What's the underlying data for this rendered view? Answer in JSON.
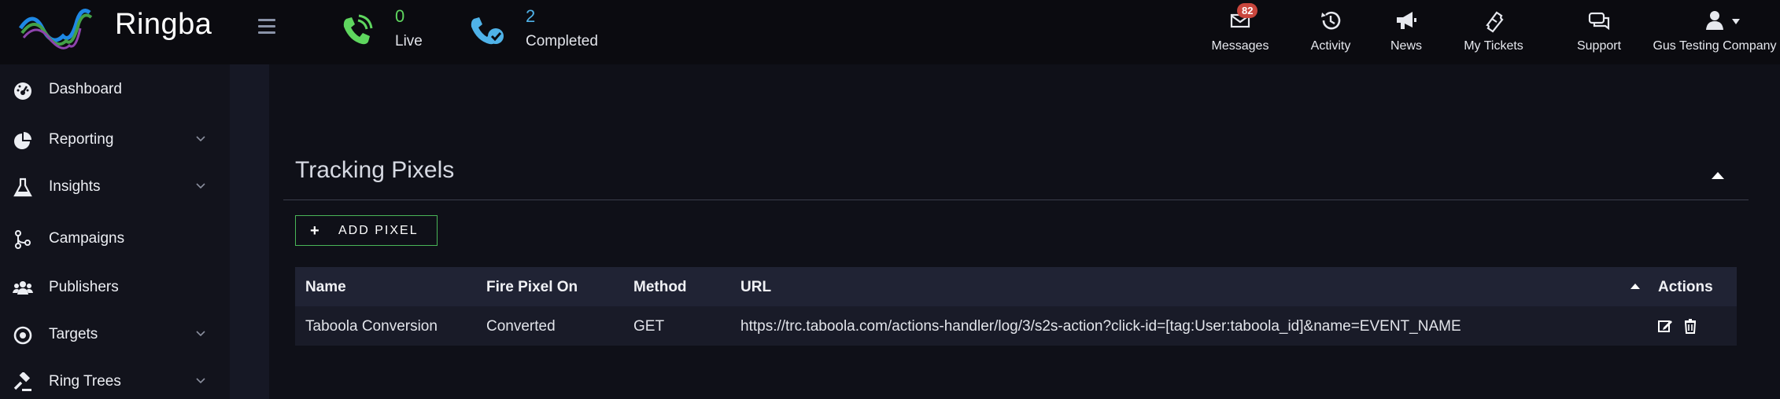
{
  "brand": {
    "name": "Ringba"
  },
  "stats": {
    "live": {
      "count": "0",
      "label": "Live",
      "icon": "phone-live-icon",
      "color": "#5fd65f"
    },
    "completed": {
      "count": "2",
      "label": "Completed",
      "icon": "phone-check-icon",
      "color": "#4fb2e8"
    }
  },
  "topnav": {
    "messages": {
      "label": "Messages",
      "badge": "82",
      "icon": "envelope-icon"
    },
    "activity": {
      "label": "Activity",
      "icon": "history-icon"
    },
    "news": {
      "label": "News",
      "icon": "megaphone-icon"
    },
    "tickets": {
      "label": "My Tickets",
      "icon": "ticket-icon"
    },
    "support": {
      "label": "Support",
      "icon": "chat-icon"
    },
    "account": {
      "label": "Gus Testing Company",
      "icon": "user-icon"
    }
  },
  "sidebar": {
    "items": [
      {
        "label": "Dashboard",
        "icon": "dashboard-icon",
        "expandable": false
      },
      {
        "label": "Reporting",
        "icon": "pie-chart-icon",
        "expandable": true
      },
      {
        "label": "Insights",
        "icon": "flask-icon",
        "expandable": true
      },
      {
        "label": "Campaigns",
        "icon": "branch-icon",
        "expandable": false
      },
      {
        "label": "Publishers",
        "icon": "users-icon",
        "expandable": false
      },
      {
        "label": "Targets",
        "icon": "target-icon",
        "expandable": true
      },
      {
        "label": "Ring Trees",
        "icon": "gavel-icon",
        "expandable": true
      }
    ]
  },
  "panel": {
    "title": "Tracking Pixels",
    "add_button": "ADD PIXEL",
    "accent": "#49b557"
  },
  "table": {
    "headers": {
      "name": "Name",
      "fire": "Fire Pixel On",
      "method": "Method",
      "url": "URL",
      "actions": "Actions"
    },
    "rows": [
      {
        "name": "Taboola Conversion",
        "fire": "Converted",
        "method": "GET",
        "url": "https://trc.taboola.com/actions-handler/log/3/s2s-action?click-id=[tag:User:taboola_id]&name=EVENT_NAME"
      }
    ]
  }
}
